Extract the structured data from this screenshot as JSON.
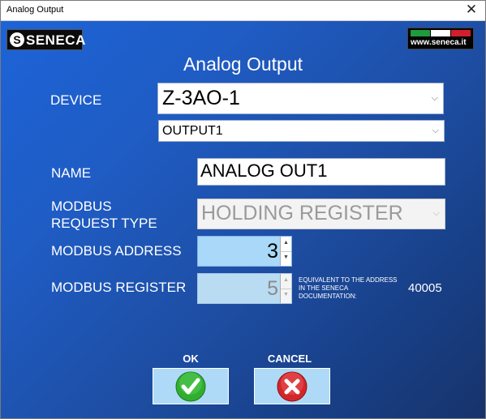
{
  "window": {
    "title": "Analog Output",
    "close_glyph": "✕"
  },
  "logo": {
    "mark": "S",
    "text": "SENECA"
  },
  "flag": {
    "url": "www.seneca.it",
    "colors": [
      "#1e9b3a",
      "#ffffff",
      "#d11f2b"
    ]
  },
  "heading": "Analog Output",
  "device": {
    "label": "DEVICE",
    "value": "Z-3AO-1",
    "output_value": "OUTPUT1"
  },
  "name": {
    "label": "NAME",
    "value": "ANALOG OUT1"
  },
  "request_type": {
    "label_line1": "MODBUS",
    "label_line2": "REQUEST TYPE",
    "value": "HOLDING REGISTER"
  },
  "address": {
    "label": "MODBUS ADDRESS",
    "value": "3"
  },
  "register": {
    "label": "MODBUS REGISTER",
    "value": "5"
  },
  "equivalent": {
    "note": "EQUIVALENT TO THE ADDRESS IN THE SENECA DOCUMENTATION:",
    "value": "40005"
  },
  "buttons": {
    "ok_label": "OK",
    "cancel_label": "CANCEL",
    "ok_icon": "check-icon",
    "cancel_icon": "x-icon"
  }
}
